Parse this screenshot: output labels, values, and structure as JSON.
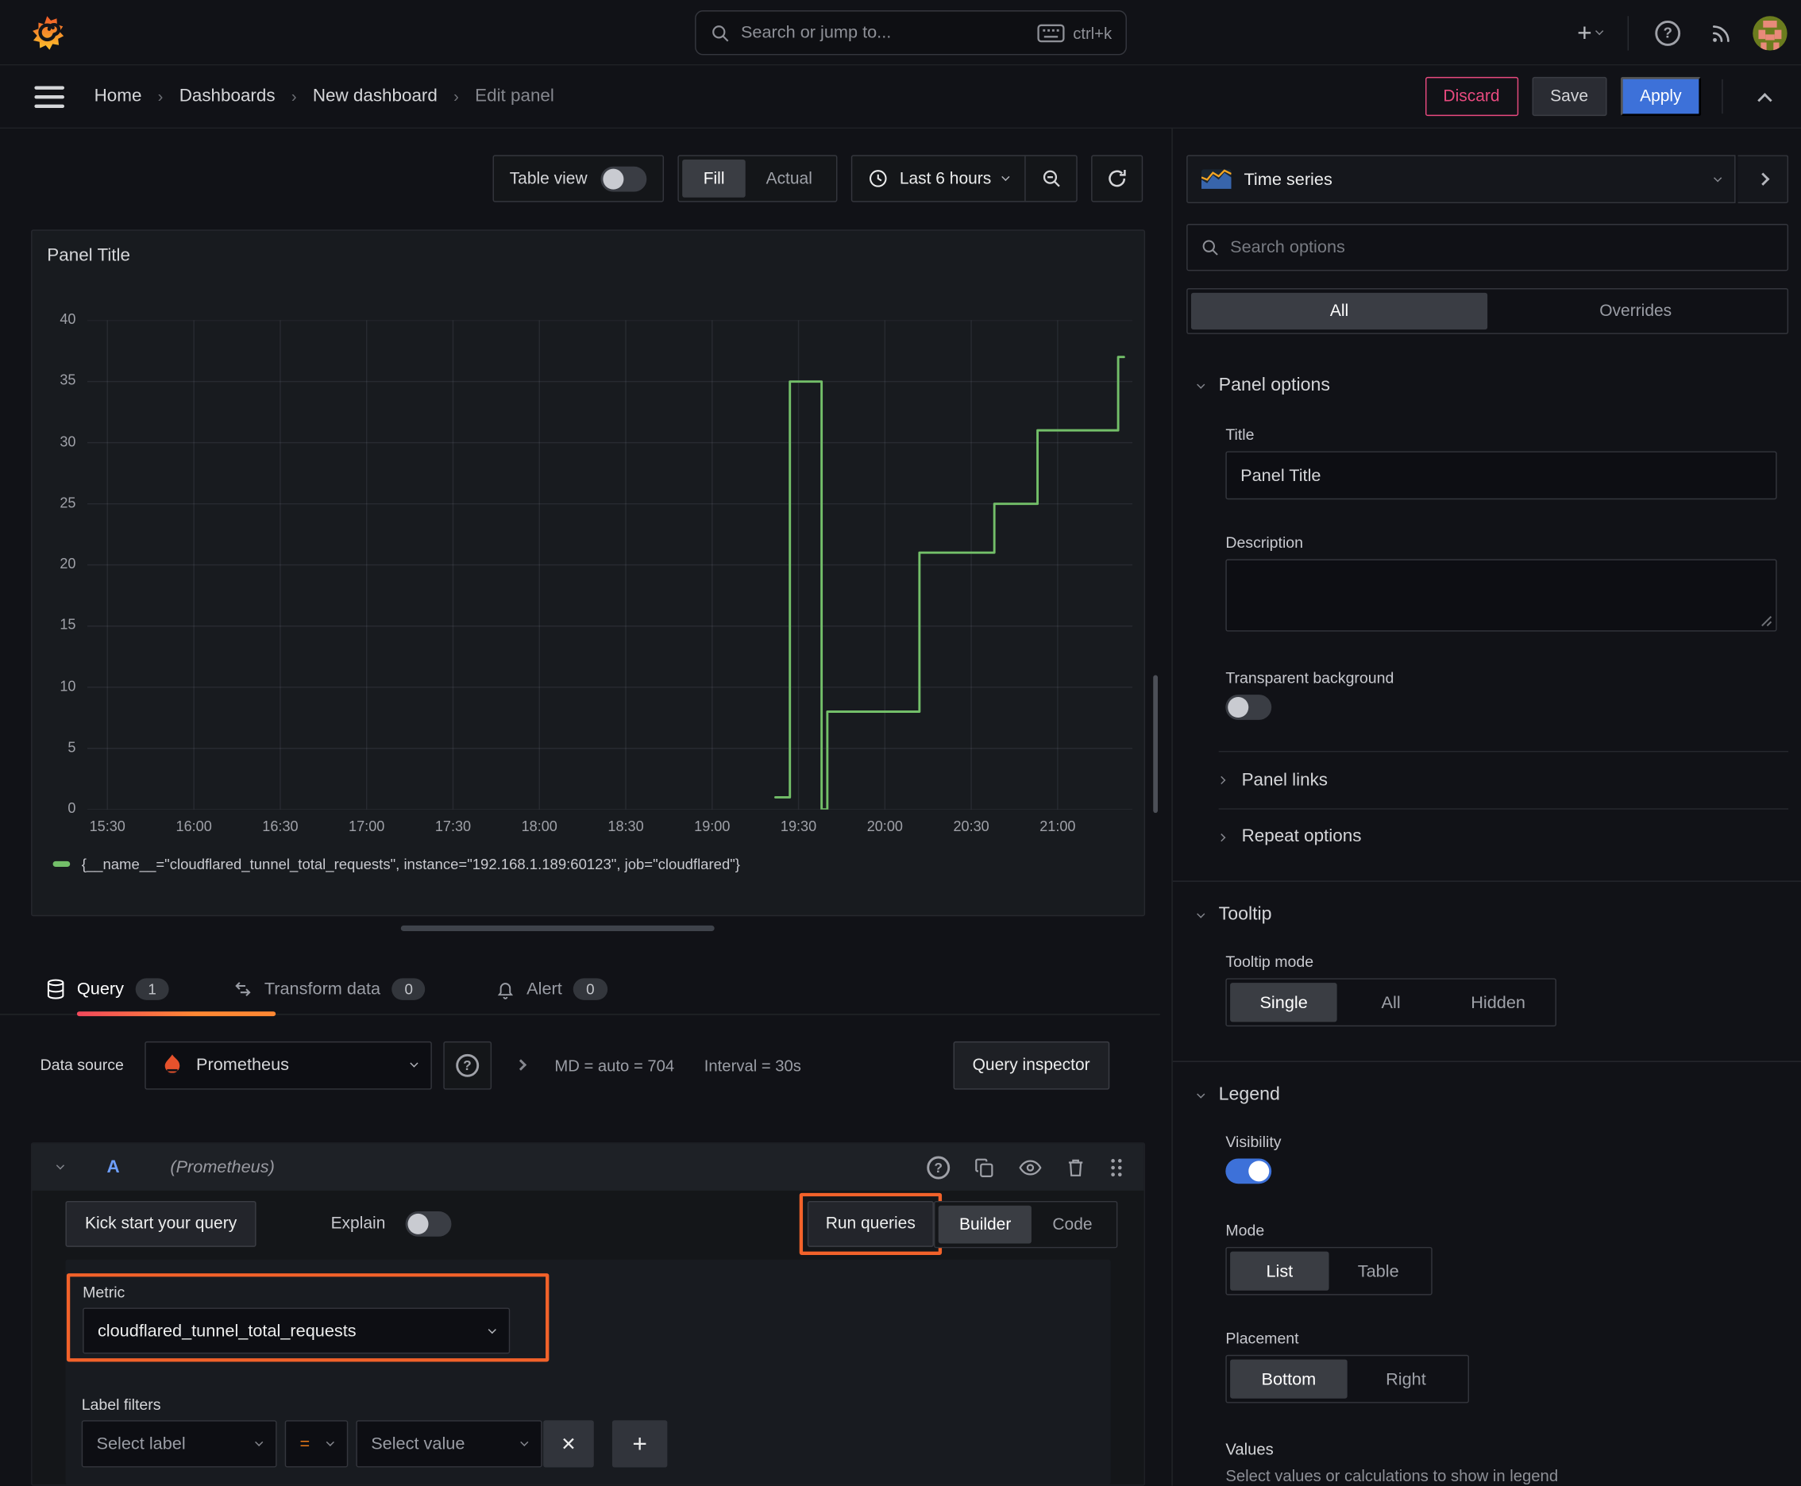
{
  "topnav": {
    "search_placeholder": "Search or jump to...",
    "shortcut": "ctrl+k"
  },
  "breadcrumb": {
    "items": [
      "Home",
      "Dashboards",
      "New dashboard",
      "Edit panel"
    ],
    "separator": "›",
    "discard_label": "Discard",
    "save_label": "Save",
    "apply_label": "Apply"
  },
  "toolbar": {
    "table_view_label": "Table view",
    "fill_label": "Fill",
    "actual_label": "Actual",
    "time_range_label": "Last 6 hours"
  },
  "panel": {
    "title": "Panel Title"
  },
  "chart_data": {
    "type": "line",
    "interpolation": "step",
    "title": "Panel Title",
    "ylim": [
      0,
      40
    ],
    "y_ticks": [
      0,
      5,
      10,
      15,
      20,
      25,
      30,
      35,
      40
    ],
    "xlim_minutes": [
      923,
      1286
    ],
    "x_ticks": [
      {
        "m": 930,
        "label": "15:30"
      },
      {
        "m": 960,
        "label": "16:00"
      },
      {
        "m": 990,
        "label": "16:30"
      },
      {
        "m": 1020,
        "label": "17:00"
      },
      {
        "m": 1050,
        "label": "17:30"
      },
      {
        "m": 1080,
        "label": "18:00"
      },
      {
        "m": 1110,
        "label": "18:30"
      },
      {
        "m": 1140,
        "label": "19:00"
      },
      {
        "m": 1170,
        "label": "19:30"
      },
      {
        "m": 1200,
        "label": "20:00"
      },
      {
        "m": 1230,
        "label": "20:30"
      },
      {
        "m": 1260,
        "label": "21:00"
      }
    ],
    "grid": true,
    "legend_position": "bottom",
    "series": [
      {
        "name": "{__name__=\"cloudflared_tunnel_total_requests\", instance=\"192.168.1.189:60123\", job=\"cloudflared\"}",
        "color": "#73bf69",
        "points": [
          [
            1162,
            1
          ],
          [
            1167,
            1
          ],
          [
            1167,
            35
          ],
          [
            1178,
            35
          ],
          [
            1178,
            0
          ],
          [
            1180,
            0
          ],
          [
            1180,
            8
          ],
          [
            1212,
            8
          ],
          [
            1212,
            21
          ],
          [
            1238,
            21
          ],
          [
            1238,
            25
          ],
          [
            1253,
            25
          ],
          [
            1253,
            31
          ],
          [
            1281,
            31
          ],
          [
            1281,
            37
          ],
          [
            1283,
            37
          ]
        ]
      }
    ]
  },
  "query_tabs": {
    "items": [
      {
        "label": "Query",
        "count": "1"
      },
      {
        "label": "Transform data",
        "count": "0"
      },
      {
        "label": "Alert",
        "count": "0"
      }
    ]
  },
  "query_bar": {
    "datasource_label": "Data source",
    "datasource_value": "Prometheus",
    "stat_max_datapoints": "MD = auto = 704",
    "stat_interval": "Interval = 30s",
    "inspector_label": "Query inspector"
  },
  "query_editor": {
    "ref_id": "A",
    "datasource_hint": "(Prometheus)",
    "kickstart_label": "Kick start your query",
    "explain_label": "Explain",
    "run_label": "Run queries",
    "builder_label": "Builder",
    "code_label": "Code",
    "metric_label": "Metric",
    "metric_value": "cloudflared_tunnel_total_requests",
    "label_filters_label": "Label filters",
    "select_label_placeholder": "Select label",
    "operator": "=",
    "select_value_placeholder": "Select value",
    "remove_glyph": "✕"
  },
  "sidebar": {
    "visualization": "Time series",
    "search_placeholder": "Search options",
    "tab_all": "All",
    "tab_overrides": "Overrides",
    "panel_options": {
      "header": "Panel options",
      "title_label": "Title",
      "title_value": "Panel Title",
      "description_label": "Description",
      "transparent_label": "Transparent background"
    },
    "panel_links_label": "Panel links",
    "repeat_options_label": "Repeat options",
    "tooltip": {
      "header": "Tooltip",
      "mode_label": "Tooltip mode",
      "single": "Single",
      "all": "All",
      "hidden": "Hidden"
    },
    "legend": {
      "header": "Legend",
      "visibility_label": "Visibility",
      "mode_label": "Mode",
      "list": "List",
      "table": "Table",
      "placement_label": "Placement",
      "bottom": "Bottom",
      "right": "Right",
      "values_label": "Values",
      "values_hint": "Select values or calculations to show in legend"
    }
  },
  "colors": {
    "accent_blue": "#3d71d9",
    "series_green": "#73bf69",
    "annotation_orange": "#f2622a",
    "discard_pink": "#e84a7f",
    "tab_gradient_start": "#f2495c",
    "tab_gradient_end": "#ff8833"
  }
}
